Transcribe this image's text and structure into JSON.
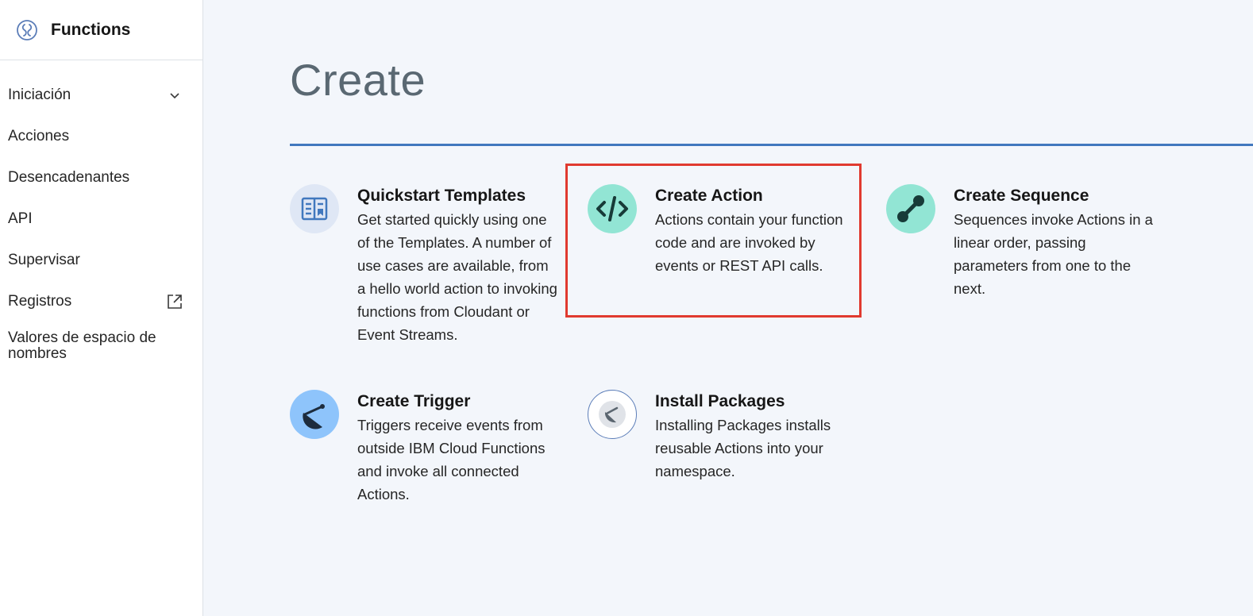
{
  "app": {
    "title": "Functions",
    "icon": "functions-logo-icon"
  },
  "sidebar": {
    "items": [
      {
        "label": "Iniciación",
        "icon": "chevron-down-icon"
      },
      {
        "label": "Acciones"
      },
      {
        "label": "Desencadenantes"
      },
      {
        "label": "API"
      },
      {
        "label": "Supervisar"
      },
      {
        "label": "Registros",
        "icon": "external-link-icon"
      },
      {
        "label": "Valores de espacio de nombres"
      }
    ]
  },
  "main": {
    "title": "Create",
    "tiles": [
      {
        "title": "Quickstart Templates",
        "description": "Get started quickly using one of the Templates. A number of use cases are available, from a hello world action to invoking functions from Cloudant or Event Streams.",
        "icon": "template-icon"
      },
      {
        "title": "Create Action",
        "description": "Actions contain your function code and are invoked by events or REST API calls.",
        "icon": "code-icon"
      },
      {
        "title": "Create Sequence",
        "description": "Sequences invoke Actions in a linear order, passing parameters from one to the next.",
        "icon": "sequence-icon"
      },
      {
        "title": "Create Trigger",
        "description": "Triggers receive events from outside IBM Cloud Functions and invoke all connected Actions.",
        "icon": "satellite-dish-icon"
      },
      {
        "title": "Install Packages",
        "description": "Installing Packages installs reusable Actions into your namespace.",
        "icon": "package-icon"
      }
    ]
  },
  "colors": {
    "accent": "#4178be",
    "teal": "#92e5d4",
    "light_blue": "#8ec4fb",
    "highlight": "#e03a2f",
    "page_background": "#f3f6fb"
  }
}
